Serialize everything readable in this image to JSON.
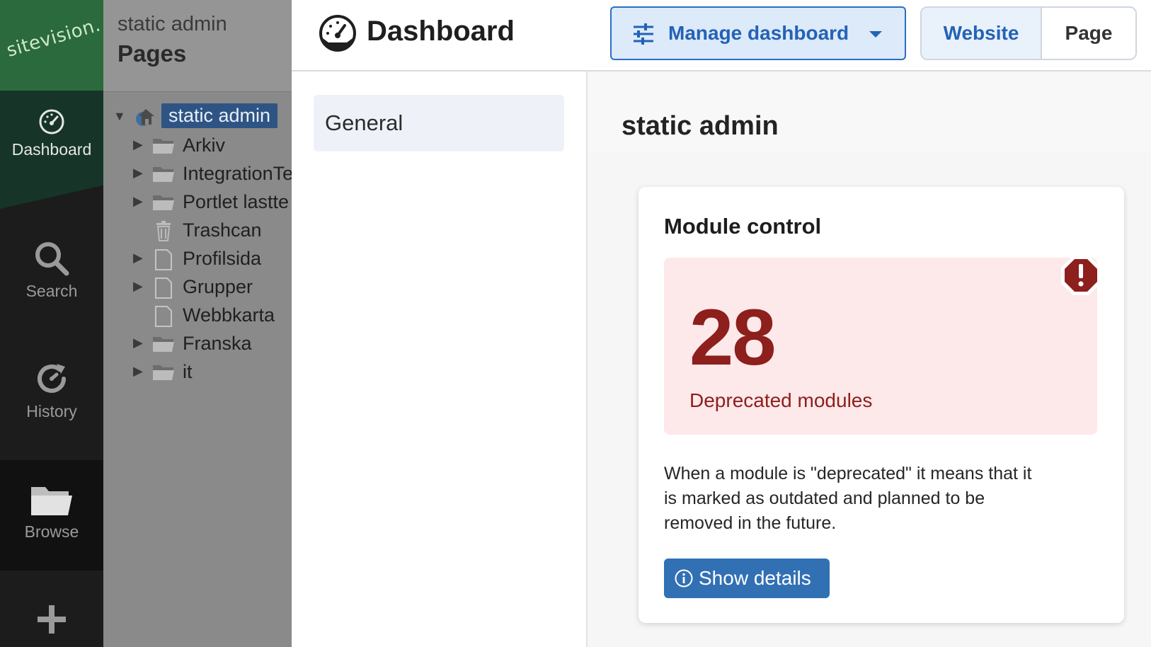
{
  "rail": {
    "logo": "sitevision.",
    "items": [
      {
        "label": "Dashboard",
        "icon": "dashboard-icon"
      },
      {
        "label": "Search",
        "icon": "search-icon"
      },
      {
        "label": "History",
        "icon": "history-icon"
      },
      {
        "label": "Browse",
        "icon": "folder-icon"
      },
      {
        "label": "",
        "icon": "plus-icon"
      }
    ]
  },
  "tree": {
    "site_name": "static admin",
    "title": "Pages",
    "root": {
      "label": "static admin",
      "icon": "site-icon"
    },
    "items": [
      {
        "label": "Arkiv",
        "icon": "folder-icon",
        "expandable": true
      },
      {
        "label": "IntegrationTe",
        "icon": "folder-icon",
        "expandable": true
      },
      {
        "label": "Portlet lastte",
        "icon": "folder-icon",
        "expandable": true
      },
      {
        "label": "Trashcan",
        "icon": "trash-icon",
        "expandable": false
      },
      {
        "label": "Profilsida",
        "icon": "page-icon",
        "expandable": true
      },
      {
        "label": "Grupper",
        "icon": "page-icon",
        "expandable": true
      },
      {
        "label": "Webbkarta",
        "icon": "page-icon",
        "expandable": false
      },
      {
        "label": "Franska",
        "icon": "folder-icon",
        "expandable": true
      },
      {
        "label": "it",
        "icon": "folder-icon",
        "expandable": true
      }
    ]
  },
  "header": {
    "title": "Dashboard",
    "manage_label": "Manage dashboard",
    "seg_website": "Website",
    "seg_page": "Page"
  },
  "subnav": {
    "items": [
      {
        "label": "General"
      }
    ]
  },
  "content": {
    "site_title": "static admin",
    "card": {
      "title": "Module control",
      "count": "28",
      "count_label": "Deprecated modules",
      "description": "When a module is \"deprecated\" it means that it is marked as outdated and planned to be removed in the future.",
      "details_label": "Show details"
    }
  },
  "colors": {
    "accent": "#2462b5",
    "alert_text": "#8d1f1c",
    "alert_bg": "#fde8ea",
    "brand_green": "#2a6a3c"
  }
}
